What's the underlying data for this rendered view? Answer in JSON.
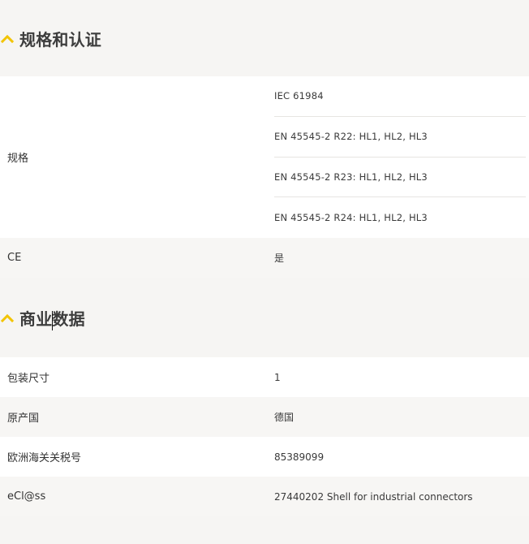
{
  "sections": [
    {
      "title": "规格和认证",
      "icon": "chevron-up-icon",
      "accent_color": "#f2c400",
      "rows": [
        {
          "label": "规格",
          "values": [
            "IEC 61984",
            "EN 45545-2 R22: HL1, HL2, HL3",
            "EN 45545-2 R23: HL1, HL2, HL3",
            "EN 45545-2 R24: HL1, HL2, HL3"
          ]
        },
        {
          "label": "CE",
          "value": "是"
        }
      ]
    },
    {
      "title": "商业数据",
      "icon": "chevron-up-icon",
      "accent_color": "#f2c400",
      "rows": [
        {
          "label": "包装尺寸",
          "value": "1"
        },
        {
          "label": "原产国",
          "value": "德国"
        },
        {
          "label": "欧洲海关关税号",
          "value": "85389099"
        },
        {
          "label": "eCl@ss",
          "value": "27440202 Shell for industrial connectors"
        }
      ]
    }
  ]
}
